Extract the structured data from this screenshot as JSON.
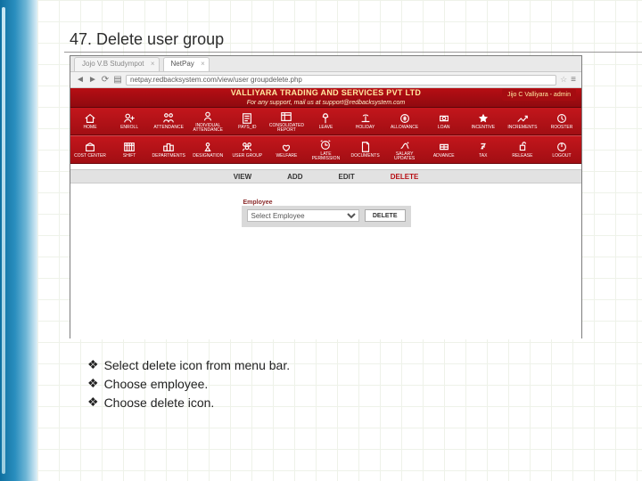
{
  "slide": {
    "title": "47. Delete user group",
    "bullets": [
      "Select delete icon from menu bar.",
      "Choose employee.",
      "Choose delete icon."
    ]
  },
  "tabs": [
    {
      "label": "Jojo V.B Studympot"
    },
    {
      "label": "NetPay"
    }
  ],
  "address": {
    "url": "netpay.redbacksystem.com/view/user groupdelete.php"
  },
  "header": {
    "company": "VALLIYARA TRADING AND SERVICES PVT LTD",
    "support": "For any support, mail us at support@redbacksystem.com",
    "user": "Jijo C Valliyara - admin"
  },
  "icons_row1": [
    {
      "name": "home-icon",
      "label": "HOME"
    },
    {
      "name": "enroll-icon",
      "label": "ENROLL"
    },
    {
      "name": "attendance-icon",
      "label": "ATTENDANCE"
    },
    {
      "name": "individual-attendance-icon",
      "label": "INDIVIDUAL\nATTENDANCE"
    },
    {
      "name": "payslip-icon",
      "label": "PAYS_ID"
    },
    {
      "name": "consolidated-report-icon",
      "label": "CONSOLIDATED\nREPORT"
    },
    {
      "name": "leave-icon",
      "label": "LEAVE"
    },
    {
      "name": "holiday-icon",
      "label": "HOLIDAY"
    },
    {
      "name": "allowance-icon",
      "label": "ALLOWANCE"
    },
    {
      "name": "loan-icon",
      "label": "LOAN"
    },
    {
      "name": "incentive-icon",
      "label": "INCENTIVE"
    },
    {
      "name": "increments-icon",
      "label": "INCREMENTS"
    },
    {
      "name": "rooster-icon",
      "label": "ROOSTER"
    }
  ],
  "icons_row2": [
    {
      "name": "cost-center-icon",
      "label": "COST CENTER"
    },
    {
      "name": "shift-icon",
      "label": "SHIFT"
    },
    {
      "name": "departments-icon",
      "label": "DEPARTMENTS"
    },
    {
      "name": "designation-icon",
      "label": "DESIGNATION"
    },
    {
      "name": "user-group-icon",
      "label": "USER GROUP"
    },
    {
      "name": "welfare-icon",
      "label": "WELFARE"
    },
    {
      "name": "late-permission-icon",
      "label": "LATE PERMISSION"
    },
    {
      "name": "documents-icon",
      "label": "DOCUMENTS"
    },
    {
      "name": "salary-updates-icon",
      "label": "SALARY UPDATES"
    },
    {
      "name": "advance-icon",
      "label": "ADVANCE"
    },
    {
      "name": "tax-icon",
      "label": "TAX"
    },
    {
      "name": "release-icon",
      "label": "RELEASE"
    },
    {
      "name": "logout-icon",
      "label": "LOGOUT"
    }
  ],
  "submenu": {
    "view": "VIEW",
    "add": "ADD",
    "edit": "EDIT",
    "delete": "DELETE"
  },
  "form": {
    "label": "Employee",
    "placeholder": "Select Employee",
    "button": "DELETE"
  }
}
